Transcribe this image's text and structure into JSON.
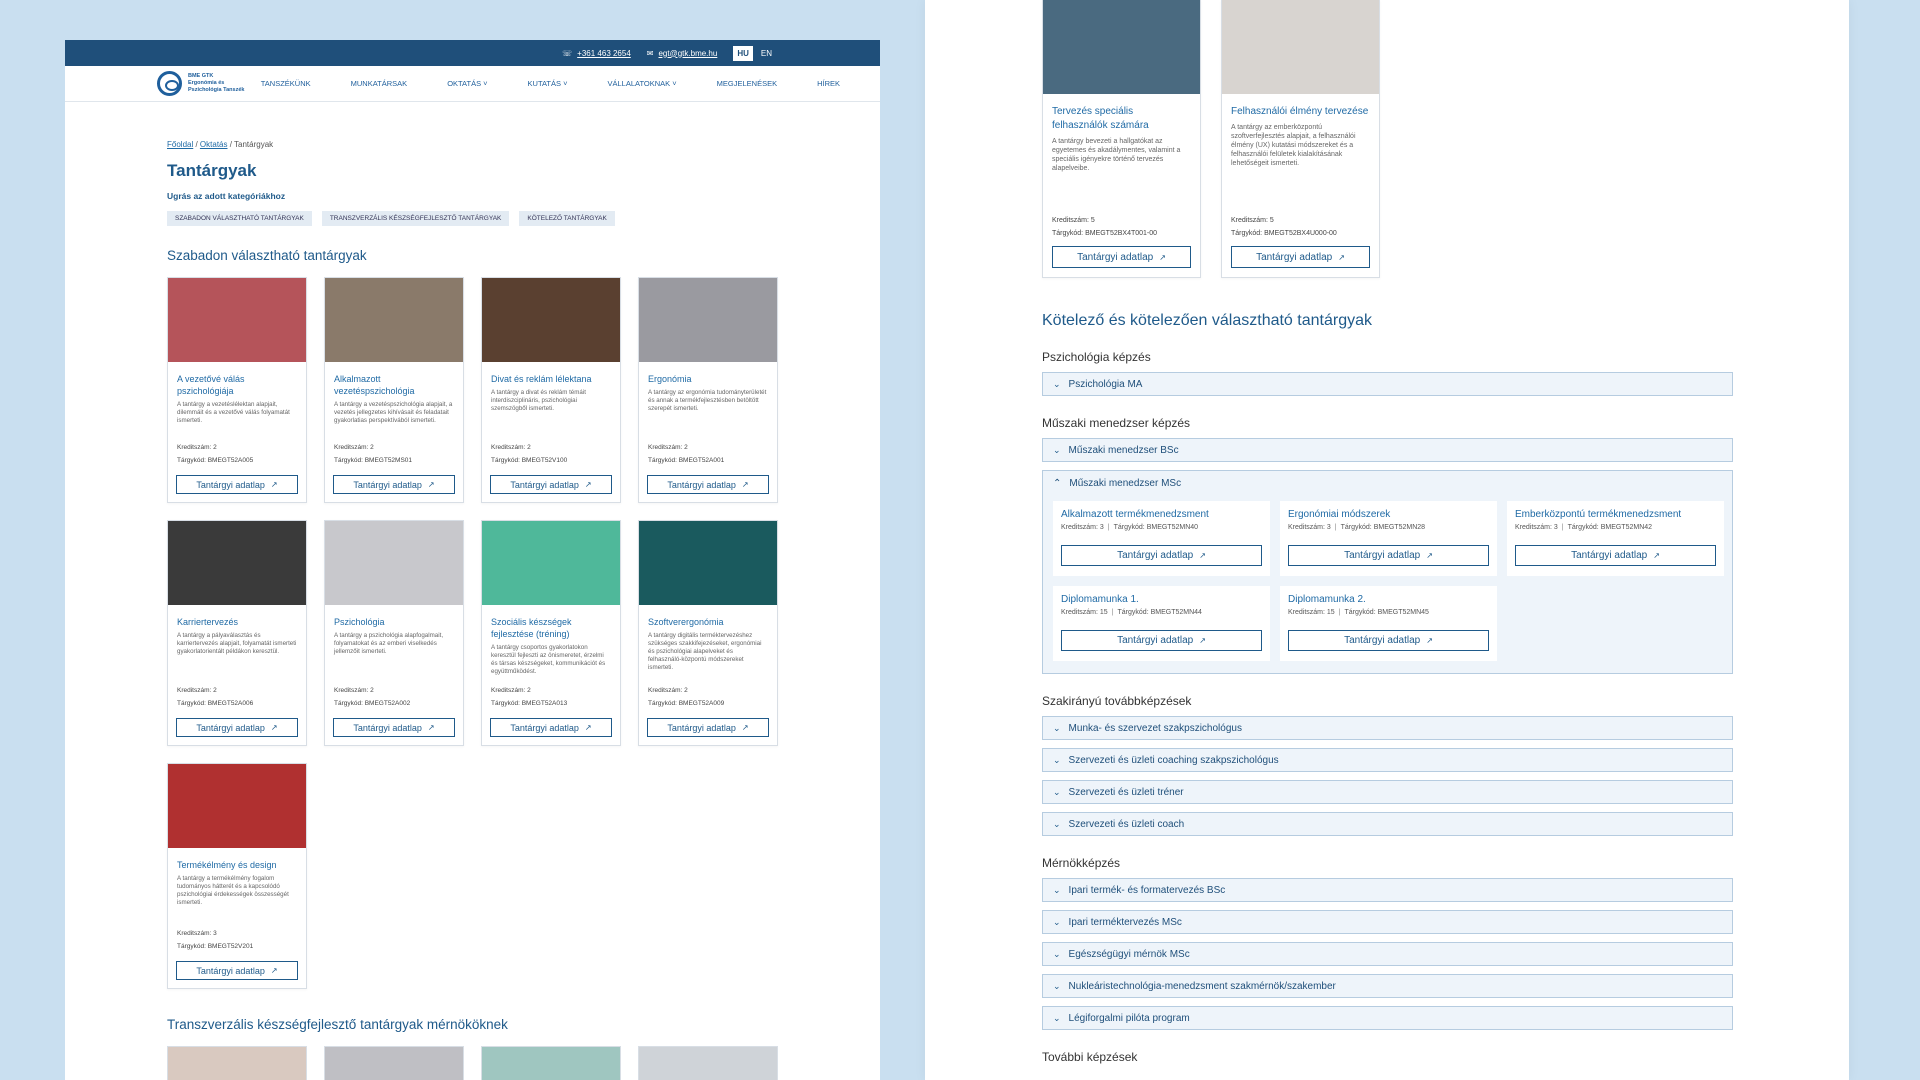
{
  "topbar": {
    "phone": "+361 463 2654",
    "email": "egt@gtk.bme.hu",
    "lang_hu": "HU",
    "lang_en": "EN"
  },
  "logo": {
    "line1": "BME GTK",
    "line2": "Ergonómia és",
    "line3": "Pszichológia Tanszék"
  },
  "nav": [
    "TANSZÉKÜNK",
    "MUNKATÁRSAK",
    "OKTATÁS ˅",
    "KUTATÁS ˅",
    "VÁLLALATOKNAK ˅",
    "MEGJELENÉSEK",
    "HÍREK"
  ],
  "breadcrumb": {
    "home": "Főoldal",
    "sep1": " / ",
    "edu": "Oktatás",
    "sep2": " / ",
    "current": "Tantárgyak"
  },
  "page": {
    "title": "Tantárgyak",
    "jump": "Ugrás az adott kategóriákhoz"
  },
  "chips": [
    "SZABADON VÁLASZTHATÓ TANTÁRGYAK",
    "TRANSZVERZÁLIS KÉSZSÉGFEJLESZTŐ TANTÁRGYAK",
    "KÖTELEZŐ TANTÁRGYAK"
  ],
  "section1": "Szabadon választható tantárgyak",
  "section2": "Transzverzális készségfejlesztő tantárgyak mérnököknek",
  "button_label": "Tantárgyi adatlap",
  "cards": [
    {
      "title": "A vezetővé válás pszichológiája",
      "desc": "A tantárgy a vezetéslélektan alapjait, dilemmáit és a vezetővé válás folyamatát ismerteti.",
      "credit": "Kreditszám: 2",
      "code": "Tárgykód: BMEGT52A005",
      "color": "#b5545a"
    },
    {
      "title": "Alkalmazott vezetéspszichológia",
      "desc": "A tantárgy a vezetéspszichológia alapjait, a vezetés jellegzetes kihívásait és feladatait gyakorlatias perspektívából ismerteti.",
      "credit": "Kreditszám: 2",
      "code": "Tárgykód: BMEGT52MS01",
      "color": "#8a7a6a"
    },
    {
      "title": "Divat és reklám lélektana",
      "desc": "A tantárgy a divat és reklám témáit interdiszciplináris, pszichológiai szemszögből ismerteti.",
      "credit": "Kreditszám: 2",
      "code": "Tárgykód: BMEGT52V100",
      "color": "#5a4030"
    },
    {
      "title": "Ergonómia",
      "desc": "A tantárgy az ergonómia tudományterületét és annak a termékfejlesztésben betöltött szerepét ismerteti.",
      "credit": "Kreditszám: 2",
      "code": "Tárgykód: BMEGT52A001",
      "color": "#9a9aa0"
    },
    {
      "title": "Karriertervezés",
      "desc": "A tantárgy a pályaválasztás és karriertervezés alapjait, folyamatát ismerteti gyakorlatorientált példákon keresztül.",
      "credit": "Kreditszám: 2",
      "code": "Tárgykód: BMEGT52A006",
      "color": "#3a3a3a"
    },
    {
      "title": "Pszichológia",
      "desc": "A tantárgy a pszichológia alapfogalmait, folyamatokat és az emberi viselkedés jellemzőit ismerteti.",
      "credit": "Kreditszám: 2",
      "code": "Tárgykód: BMEGT52A002",
      "color": "#c8c8cc"
    },
    {
      "title": "Szociális készségek fejlesztése (tréning)",
      "desc": "A tantárgy csoportos gyakorlatokon keresztül fejleszti az önismeretet, érzelmi és társas készségeket, kommunikációt és együttműködést.",
      "credit": "Kreditszám: 2",
      "code": "Tárgykód: BMEGT52A013",
      "color": "#4fb89a"
    },
    {
      "title": "Szoftverergonómia",
      "desc": "A tantárgy digitális terméktervezéshez szükséges szakkifejezéseket, ergonómiai és pszichológiai alapelveket és felhasználó-központú módszereket ismerteti.",
      "credit": "Kreditszám: 2",
      "code": "Tárgykód: BMEGT52A009",
      "color": "#1a5a5e"
    },
    {
      "title": "Termékélmény és design",
      "desc": "A tantárgy a termékélmény fogalom tudományos hátterét és a kapcsolódó pszichológiai érdekességek összességét ismerteti.",
      "credit": "Kreditszám: 3",
      "code": "Tárgykód: BMEGT52V201",
      "color": "#b03030"
    }
  ],
  "right_cards": [
    {
      "title": "Tervezés speciális felhasználók számára",
      "desc": "A tantárgy bevezeti a hallgatókat az egyetemes és akadálymentes, valamint a speciális igényekre történő tervezés alapelveibe.",
      "credit": "Kreditszám: 5",
      "code": "Tárgykód: BMEGT52BX4T001-00",
      "color": "#4a6a80"
    },
    {
      "title": "Felhasználói élmény tervezése",
      "desc": "A tantárgy az emberközpontú szoftverfejlesztés alapjait, a felhasználói élmény (UX) kutatási módszereket és a felhasználói felületek kialakításának lehetőségeit ismerteti.",
      "credit": "Kreditszám: 5",
      "code": "Tárgykód: BMEGT52BX4U000-00",
      "color": "#d8d4d0"
    }
  ],
  "mandatory_title": "Kötelező és kötelezően választható tantárgyak",
  "groups": {
    "psych": {
      "label": "Pszichológia képzés",
      "items": [
        "Pszichológia MA"
      ]
    },
    "muszaki": {
      "label": "Műszaki menedzser képzés",
      "items": [
        "Műszaki menedzser BSc"
      ],
      "open": "Műszaki menedzser MSc",
      "subjects": [
        {
          "title": "Alkalmazott termékmenedzsment",
          "credit": "Kreditszám: 3",
          "code": "Tárgykód: BMEGT52MN40"
        },
        {
          "title": "Ergonómiai módszerek",
          "credit": "Kreditszám: 3",
          "code": "Tárgykód: BMEGT52MN28"
        },
        {
          "title": "Emberközpontú termékmenedzsment",
          "credit": "Kreditszám: 3",
          "code": "Tárgykód: BMEGT52MN42"
        },
        {
          "title": "Diplomamunka 1.",
          "credit": "Kreditszám: 15",
          "code": "Tárgykód: BMEGT52MN44"
        },
        {
          "title": "Diplomamunka 2.",
          "credit": "Kreditszám: 15",
          "code": "Tárgykód: BMEGT52MN45"
        }
      ]
    },
    "szakirany": {
      "label": "Szakirányú továbbképzések",
      "items": [
        "Munka- és szervezet szakpszichológus",
        "Szervezeti és üzleti coaching szakpszichológus",
        "Szervezeti és üzleti tréner",
        "Szervezeti és üzleti coach"
      ]
    },
    "mernok": {
      "label": "Mérnökképzés",
      "items": [
        "Ipari termék- és formatervezés BSc",
        "Ipari terméktervezés MSc",
        "Egészségügyi mérnök MSc",
        "Nukleáristechnológia-menedzsment szakmérnök/szakember",
        "Légiforgalmi pilóta program"
      ]
    },
    "tovabbi": {
      "label": "További képzések"
    }
  },
  "colors": {
    "brand": "#1f4f7a",
    "link": "#1f6aa5",
    "background": "#c9dff0"
  }
}
